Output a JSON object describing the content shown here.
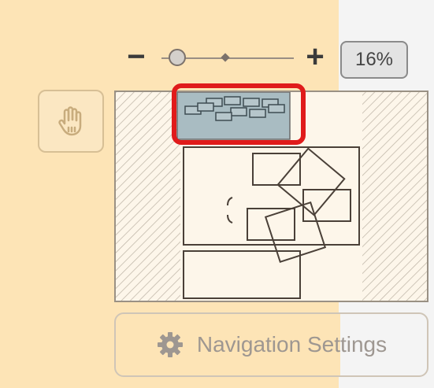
{
  "zoom": {
    "minus_label": "−",
    "plus_label": "+",
    "percent_label": "16%",
    "level_fraction": 0.08
  },
  "tools": {
    "hand_icon": "hand-icon"
  },
  "navigation": {
    "settings_label": "Navigation Settings",
    "settings_icon": "gear-icon"
  },
  "colors": {
    "panel_bg": "#fde4b6",
    "highlight": "#e01b1b",
    "viewport_fill": "#a9bcc2"
  }
}
